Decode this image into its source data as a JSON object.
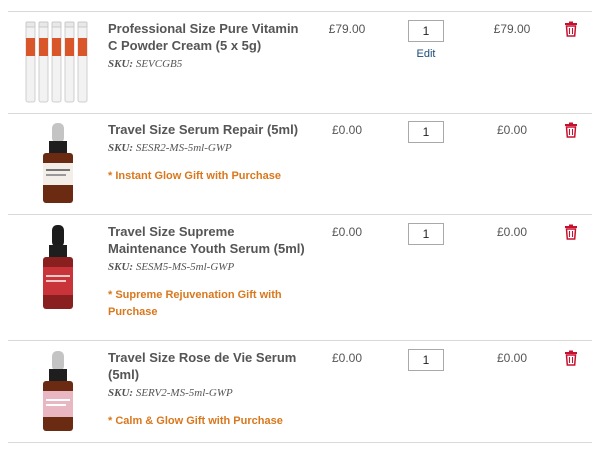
{
  "colors": {
    "gift_note": "#d9771c",
    "edit_link": "#1b4a78",
    "delete_icon": "#c8102e",
    "divider": "#d9d9d9"
  },
  "items": [
    {
      "title": "Professional Size Pure Vitamin C Powder Cream (5 x 5g)",
      "sku_label": "SKU:",
      "sku": "SEVCGB5",
      "gift_note": "",
      "price": "£79.00",
      "quantity": "1",
      "edit_label": "Edit",
      "total": "£79.00",
      "image_icon": "vitamin-c-tubes-icon"
    },
    {
      "title": "Travel Size Serum Repair (5ml)",
      "sku_label": "SKU:",
      "sku": "SESR2-MS-5ml-GWP",
      "gift_note": "* Instant Glow Gift with Purchase",
      "price": "£0.00",
      "quantity": "1",
      "edit_label": "",
      "total": "£0.00",
      "image_icon": "dropper-bottle-icon"
    },
    {
      "title": "Travel Size Supreme Maintenance Youth Serum (5ml)",
      "sku_label": "SKU:",
      "sku": "SESM5-MS-5ml-GWP",
      "gift_note": "* Supreme Rejuvenation Gift with Purchase",
      "price": "£0.00",
      "quantity": "1",
      "edit_label": "",
      "total": "£0.00",
      "image_icon": "dropper-bottle-icon"
    },
    {
      "title": "Travel Size Rose de Vie Serum (5ml)",
      "sku_label": "SKU:",
      "sku": "SERV2-MS-5ml-GWP",
      "gift_note": "* Calm & Glow Gift with Purchase",
      "price": "£0.00",
      "quantity": "1",
      "edit_label": "",
      "total": "£0.00",
      "image_icon": "dropper-bottle-icon"
    }
  ]
}
